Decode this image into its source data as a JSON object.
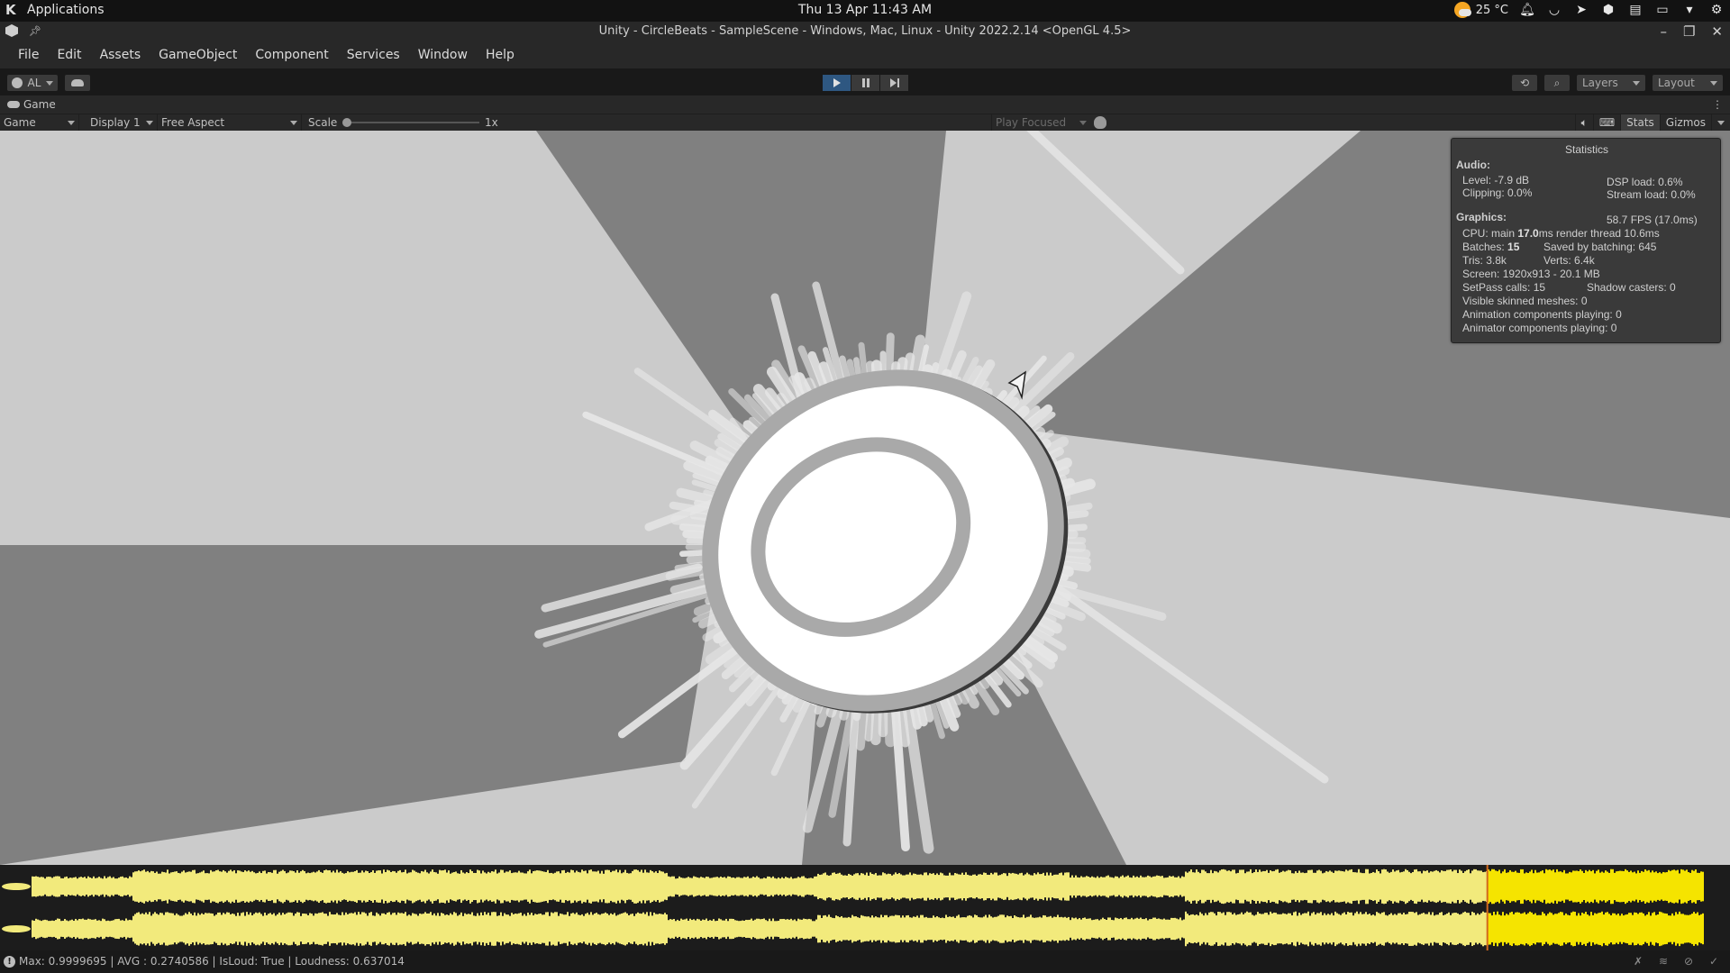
{
  "system_bar": {
    "applications_label": "Applications",
    "clock": "Thu 13 Apr 11:43 AM",
    "weather_temp": "25 °C",
    "tray_icons": [
      "weather-icon",
      "notification-bell-icon",
      "bowl-icon",
      "send-icon",
      "unity-hub-icon",
      "clipboard-icon",
      "display-icon",
      "tray-expand-icon",
      "settings-gear-icon"
    ]
  },
  "window": {
    "title": "Unity - CircleBeats - SampleScene - Windows, Mac, Linux - Unity 2022.2.14 <OpenGL 4.5>",
    "controls": {
      "minimize": "–",
      "maximize": "❐",
      "close": "✕"
    }
  },
  "menu": [
    "File",
    "Edit",
    "Assets",
    "GameObject",
    "Component",
    "Services",
    "Window",
    "Help"
  ],
  "toolbar": {
    "account_label": "AL",
    "play_state": "playing",
    "layers_label": "Layers",
    "layout_label": "Layout"
  },
  "game_tab": {
    "label": "Game",
    "view_select": "Game",
    "display_select": "Display 1",
    "aspect_select": "Free Aspect",
    "scale_label": "Scale",
    "scale_value": "1x",
    "scale_slider_fraction": 0,
    "play_mode_select": "Play Focused",
    "stats_label": "Stats",
    "stats_enabled": true,
    "gizmos_label": "Gizmos"
  },
  "statistics": {
    "title": "Statistics",
    "audio_heading": "Audio:",
    "level": "Level: -7.9 dB",
    "clipping": "Clipping: 0.0%",
    "dsp_load": "DSP load: 0.6%",
    "stream_load": "Stream load: 0.0%",
    "graphics_heading": "Graphics:",
    "fps": "58.7 FPS (17.0ms)",
    "cpu_prefix": "CPU: main ",
    "cpu_main": "17.0",
    "cpu_suffix": "ms  render thread 10.6ms",
    "batches_prefix": "Batches: ",
    "batches": "15",
    "saved_by_batching": "Saved by batching: 645",
    "tris": "Tris: 3.8k",
    "verts": "Verts: 6.4k",
    "screen": "Screen: 1920x913 - 20.1 MB",
    "setpass": "SetPass calls: 15",
    "shadow_casters": "Shadow casters: 0",
    "skinned_meshes": "Visible skinned meshes: 0",
    "animation_components": "Animation components playing: 0",
    "animator_components": "Animator components playing: 0"
  },
  "scene": {
    "background_light": "#cbcbcb",
    "background_dark": "#808080",
    "ring_color": "#a9a9a9",
    "disc_color": "#ffffff",
    "bar_color": "#e6e6e6"
  },
  "waveform": {
    "color_played": "#f2ea7c",
    "color_unplayed": "#f5e400",
    "playhead_color": "#d2691e",
    "playhead_fraction": 0.871,
    "channels": 2
  },
  "status_bar": {
    "message": "Max: 0.9999695 | AVG : 0.2740586 | IsLoud: True | Loudness: 0.637014"
  }
}
